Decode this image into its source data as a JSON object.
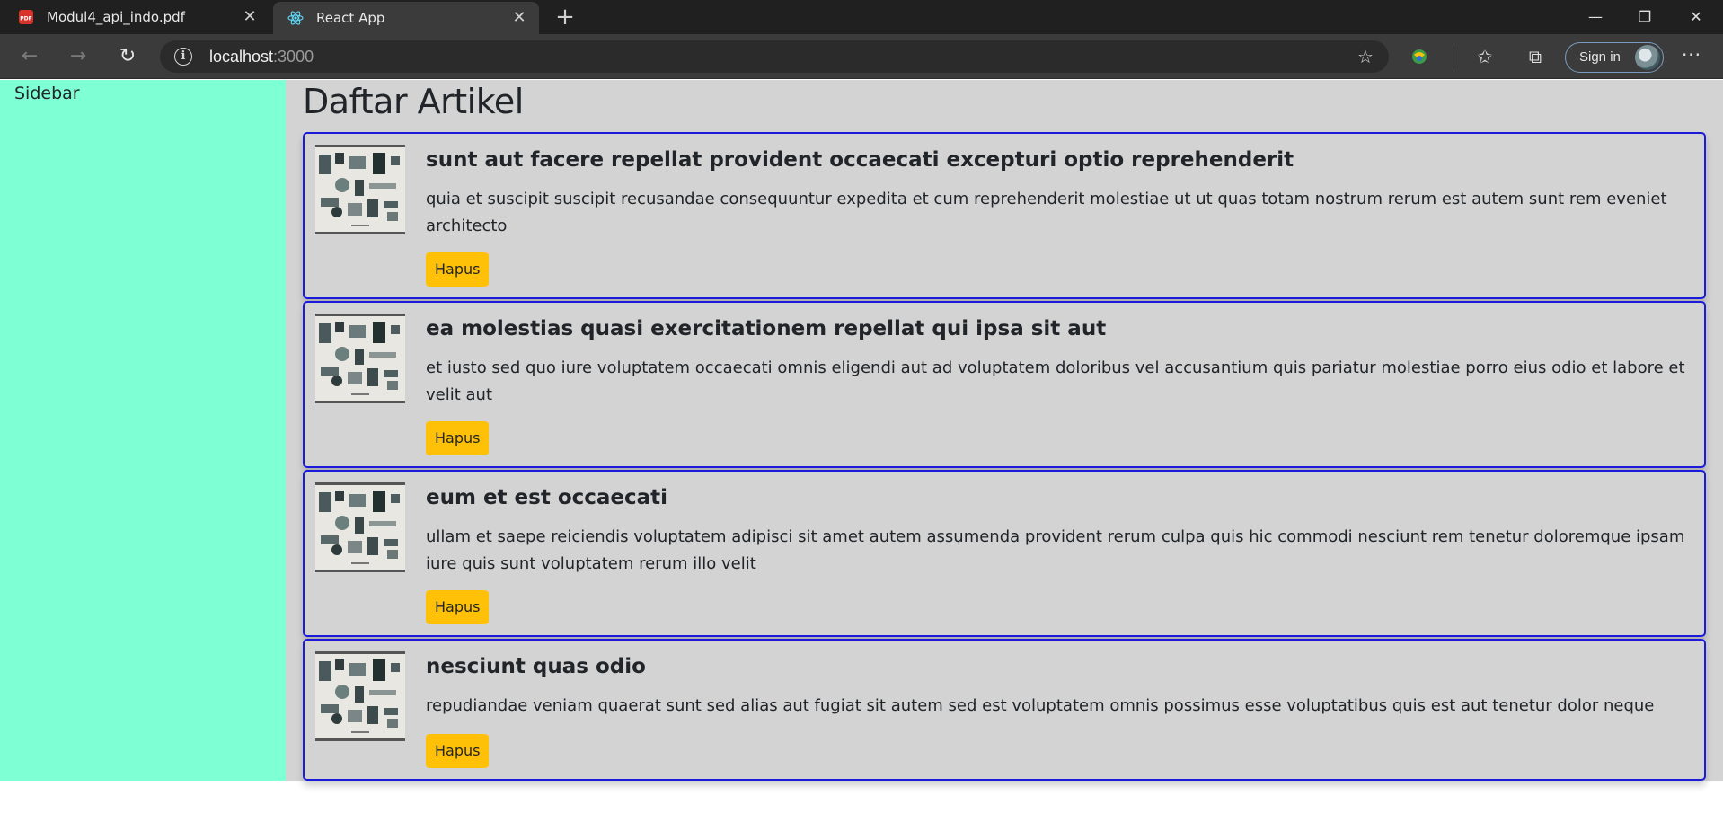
{
  "browser": {
    "tabs": [
      {
        "title": "Modul4_api_indo.pdf",
        "icon": "pdf-icon",
        "active": false
      },
      {
        "title": "React App",
        "icon": "react-icon",
        "active": true
      }
    ],
    "new_tab_icon": "+",
    "url_host": "localhost",
    "url_port": ":3000",
    "sign_in_label": "Sign in"
  },
  "sidebar": {
    "label": "Sidebar"
  },
  "main": {
    "heading": "Daftar Artikel",
    "delete_label": "Hapus",
    "articles": [
      {
        "title": "sunt aut facere repellat provident occaecati excepturi optio reprehenderit",
        "body": "quia et suscipit suscipit recusandae consequuntur expedita et cum reprehenderit molestiae ut ut quas totam nostrum rerum est autem sunt rem eveniet architecto"
      },
      {
        "title": "ea molestias quasi exercitationem repellat qui ipsa sit aut",
        "body": "et iusto sed quo iure voluptatem occaecati omnis eligendi aut ad voluptatem doloribus vel accusantium quis pariatur molestiae porro eius odio et labore et velit aut"
      },
      {
        "title": "eum et est occaecati",
        "body": "ullam et saepe reiciendis voluptatem adipisci sit amet autem assumenda provident rerum culpa quis hic commodi nesciunt rem tenetur doloremque ipsam iure quis sunt voluptatem rerum illo velit"
      },
      {
        "title": "nesciunt quas odio",
        "body": "repudiandae veniam quaerat sunt sed alias aut fugiat sit autem sed est voluptatem omnis possimus esse voluptatibus quis est aut tenetur dolor neque"
      }
    ]
  },
  "colors": {
    "sidebar_bg": "#7fffd4",
    "main_bg": "#d3d3d3",
    "card_border": "#1a1ad8",
    "button_bg": "#ffc107"
  }
}
